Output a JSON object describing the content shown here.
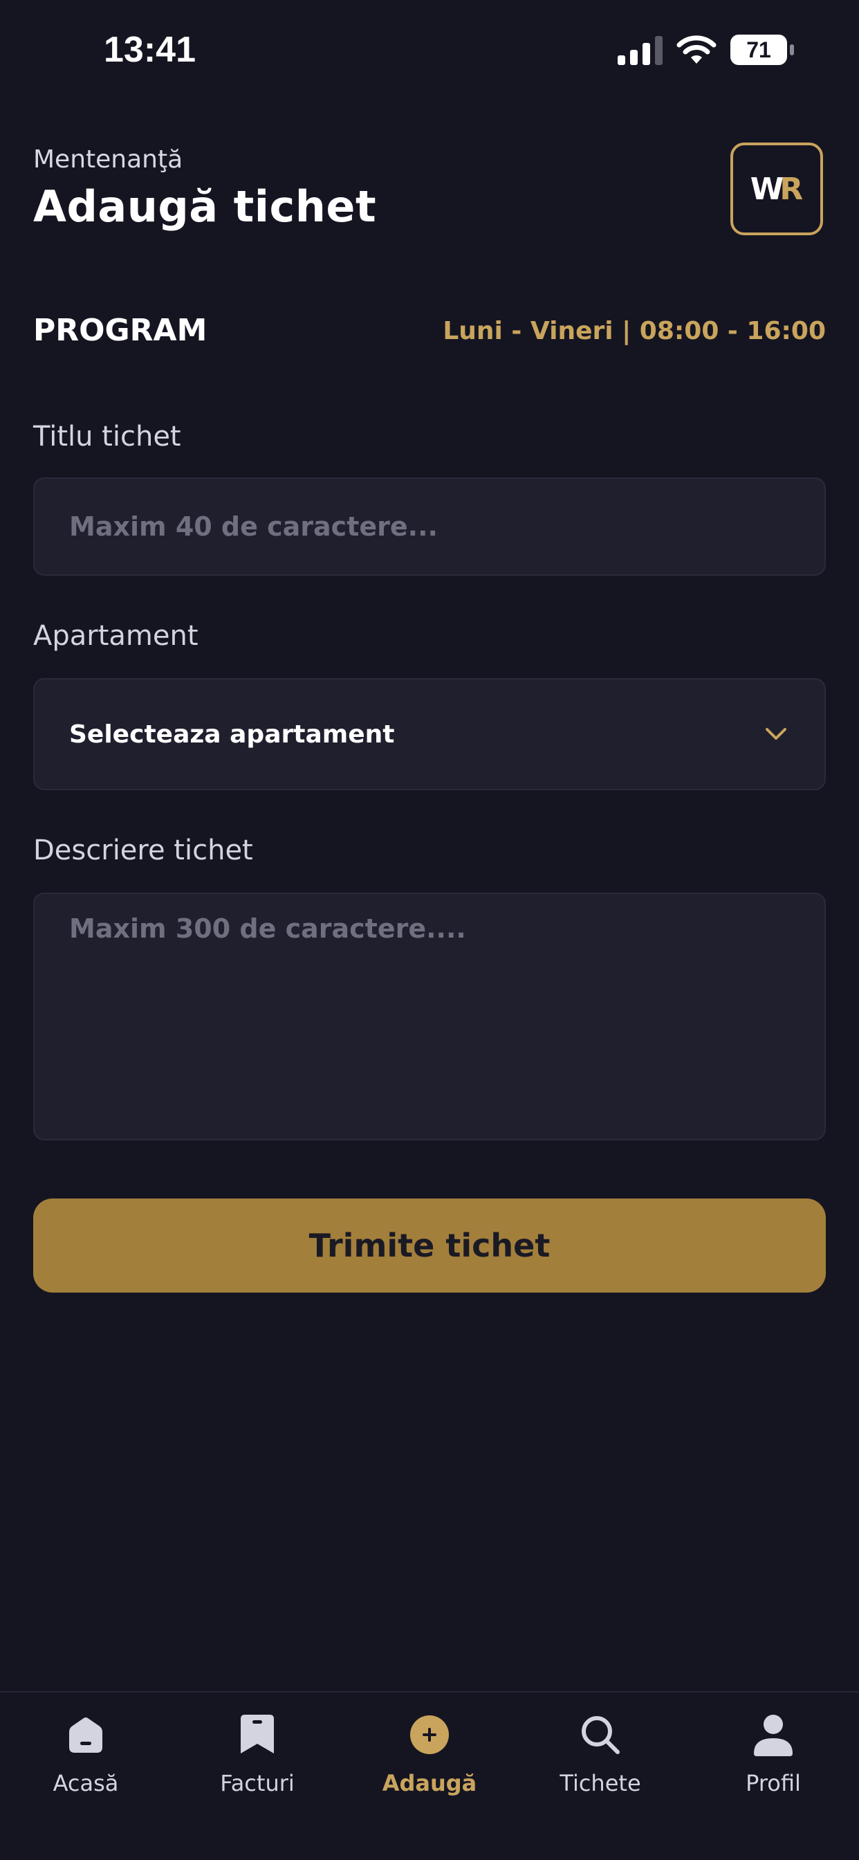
{
  "status_bar": {
    "time": "13:41",
    "battery": "71",
    "icons": [
      "signal-icon",
      "wifi-icon",
      "battery-icon"
    ]
  },
  "header": {
    "subtitle": "Mentenanţă",
    "title": "Adaugă tichet",
    "logo": {
      "letter_1": "W",
      "letter_2": "R"
    }
  },
  "program": {
    "label": "PROGRAM",
    "hours": "Luni - Vineri | 08:00 - 16:00"
  },
  "form": {
    "title_label": "Titlu tichet",
    "title_placeholder": "Maxim 40 de caractere...",
    "title_value": "",
    "apartment_label": "Apartament",
    "apartment_selected": "Selecteaza apartament",
    "description_label": "Descriere tichet",
    "description_placeholder": "Maxim 300 de caractere....",
    "description_value": "",
    "submit_label": "Trimite tichet"
  },
  "nav": {
    "items": [
      {
        "label": "Acasă",
        "icon": "home-icon",
        "active": false
      },
      {
        "label": "Facturi",
        "icon": "bookmark-icon",
        "active": false
      },
      {
        "label": "Adaugă",
        "icon": "add-circle-icon",
        "active": true
      },
      {
        "label": "Tichete",
        "icon": "search-icon",
        "active": false
      },
      {
        "label": "Profil",
        "icon": "user-icon",
        "active": false
      }
    ]
  },
  "colors": {
    "background": "#151522",
    "accent": "#c9a45c",
    "button": "#a37f3c",
    "input_bg": "#1f1f2e"
  }
}
